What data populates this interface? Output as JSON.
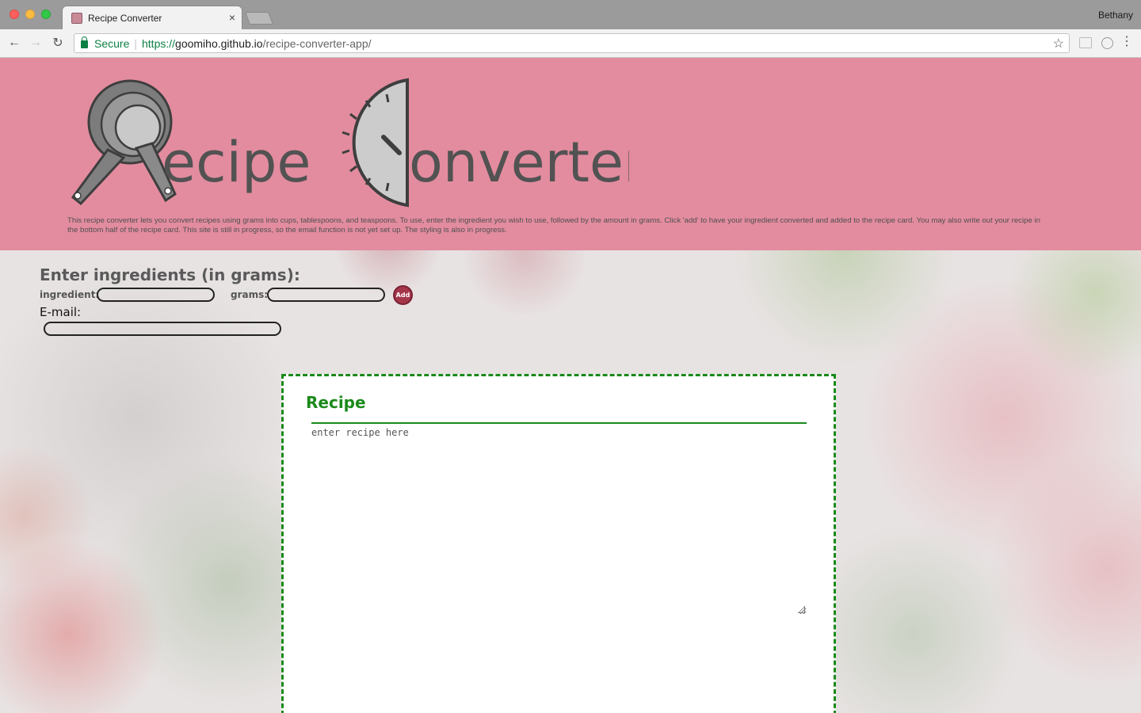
{
  "browser": {
    "tab_title": "Recipe Converter",
    "tab_close": "×",
    "profile_name": "Bethany",
    "secure_label": "Secure",
    "url_scheme": "https://",
    "url_host": "goomiho.github.io",
    "url_path": "/recipe-converter-app/",
    "icons": {
      "back": "←",
      "forward": "→",
      "reload": "↻",
      "star": "☆",
      "menu": "⋮"
    }
  },
  "banner": {
    "logo_text_1": "ecipe",
    "logo_text_2": "onverter",
    "intro": "This recipe converter lets you convert recipes using grams into cups, tablespoons, and teaspoons. To use, enter the ingredient you wish to use, followed by the amount in grams. Click 'add' to have your ingredient converted and added to the recipe card. You may also write out your recipe in the bottom half of the recipe card. This site is still in progress, so the email function is not yet set up. The styling is also in progress."
  },
  "form": {
    "heading": "Enter ingredients (in grams):",
    "ingredient_label": "ingredient:",
    "ingredient_value": "",
    "grams_label": "grams:",
    "grams_value": "",
    "add_label": "Add",
    "email_label": "E-mail:",
    "email_value": ""
  },
  "card": {
    "title": "Recipe",
    "recipe_placeholder": "enter recipe here"
  },
  "colors": {
    "banner": "#e38c9f",
    "card_border": "#1a8a1a",
    "add_button": "#a5364a"
  }
}
